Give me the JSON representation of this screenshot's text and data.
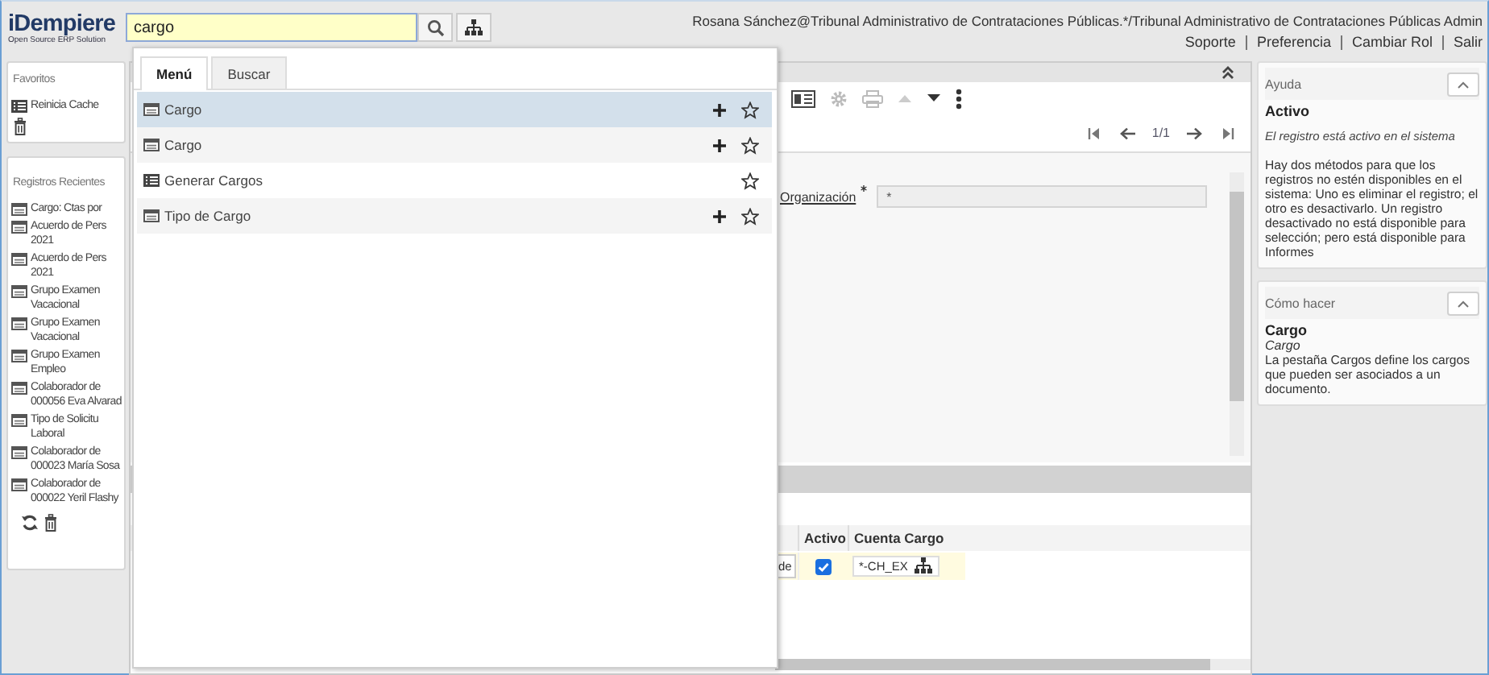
{
  "header": {
    "logo": "iDempiere",
    "tagline": "Open Source ERP Solution",
    "search": {
      "value": "cargo"
    },
    "user": "Rosana Sánchez@Tribunal Administrativo de Contrataciones Públicas.*/Tribunal Administrativo de Contrataciones Públicas Admin",
    "links": [
      "Soporte",
      "Preferencia",
      "Cambiar Rol",
      "Salir"
    ]
  },
  "favorites": {
    "title": "Favoritos",
    "items": [
      {
        "label": "Reinicia Cache",
        "kind": "process"
      }
    ]
  },
  "recent": {
    "title": "Registros Recientes",
    "items": [
      {
        "label": "Cargo: Ctas por"
      },
      {
        "label": "Acuerdo de Pers\n2021"
      },
      {
        "label": "Acuerdo de Pers\n2021"
      },
      {
        "label": "Grupo Examen\nVacacional"
      },
      {
        "label": "Grupo Examen\nVacacional"
      },
      {
        "label": "Grupo Examen\nEmpleo"
      },
      {
        "label": "Colaborador de\n000056 Eva Alvarad"
      },
      {
        "label": "Tipo de Solicitu\nLaboral"
      },
      {
        "label": "Colaborador de\n000023 María Sosa"
      },
      {
        "label": "Colaborador de\n000022 Yeril Flashy"
      }
    ]
  },
  "popup": {
    "tabs": [
      {
        "label": "Menú",
        "selected": true
      },
      {
        "label": "Buscar",
        "selected": false
      }
    ],
    "items": [
      {
        "label": "Cargo",
        "kind": "window",
        "selected": true,
        "can_add": true,
        "favorite": false
      },
      {
        "label": "Cargo",
        "kind": "window",
        "selected": false,
        "can_add": true,
        "favorite": false
      },
      {
        "label": "Generar Cargos",
        "kind": "process",
        "selected": false,
        "can_add": false,
        "favorite": false
      },
      {
        "label": "Tipo de Cargo",
        "kind": "window",
        "selected": false,
        "can_add": true,
        "favorite": false
      }
    ]
  },
  "record": {
    "navigation": "1/1",
    "fields": [
      {
        "label": "Organización",
        "required": true,
        "value": "*"
      }
    ]
  },
  "grid": {
    "columns": [
      "Activo",
      "Cuenta Cargo"
    ],
    "rows": [
      {
        "column_1": "de",
        "activo": true,
        "cuenta_cargo": "*-CH_EX"
      }
    ]
  },
  "help": {
    "title": "Ayuda",
    "heading": "Activo",
    "description": "El registro está activo en el sistema",
    "text": "Hay dos métodos para que los registros no estén disponibles en el sistema: Uno es eliminar el registro; el otro es desactivarlo. Un registro desactivado no está disponible para selección; pero está disponible para Informes"
  },
  "howto": {
    "title": "Cómo hacer",
    "heading": "Cargo",
    "subtitle": "Cargo",
    "text": "La pestaña Cargos define los cargos que pueden ser asociados a un documento."
  }
}
